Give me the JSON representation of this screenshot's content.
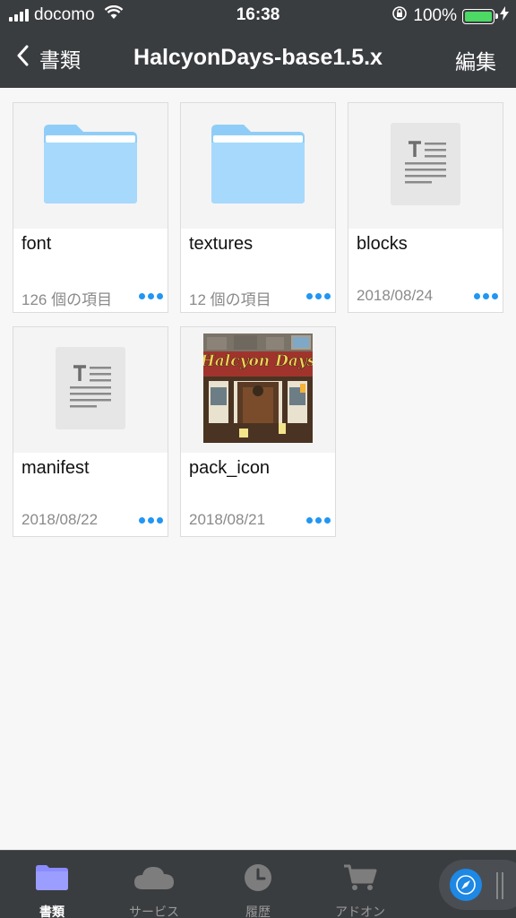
{
  "status_bar": {
    "carrier": "docomo",
    "time": "16:38",
    "battery_percent": "100%",
    "battery_level": 1.0
  },
  "nav": {
    "back_label": "書類",
    "title": "HalcyonDays-base1.5.x",
    "edit_label": "編集"
  },
  "items": [
    {
      "name": "font",
      "meta": "126 個の項目",
      "kind": "folder-icon"
    },
    {
      "name": "textures",
      "meta": "12 個の項目",
      "kind": "folder-icon"
    },
    {
      "name": "blocks",
      "meta": "2018/08/24",
      "kind": "text-document-icon"
    },
    {
      "name": "manifest",
      "meta": "2018/08/22",
      "kind": "text-document-icon"
    },
    {
      "name": "pack_icon",
      "meta": "2018/08/21",
      "kind": "image-thumbnail",
      "thumbnail_text": "Halcyon Days"
    }
  ],
  "tabs": [
    {
      "label": "書類",
      "icon": "folder-icon",
      "active": true
    },
    {
      "label": "サービス",
      "icon": "cloud-icon",
      "active": false
    },
    {
      "label": "履歴",
      "icon": "clock-icon",
      "active": false
    },
    {
      "label": "アドオン",
      "icon": "cart-icon",
      "active": false
    }
  ],
  "colors": {
    "bar_background": "#3a3d40",
    "accent": "#2196f3",
    "folder": "#9fd5fb",
    "tab_active_icon": "#8a8cff"
  }
}
